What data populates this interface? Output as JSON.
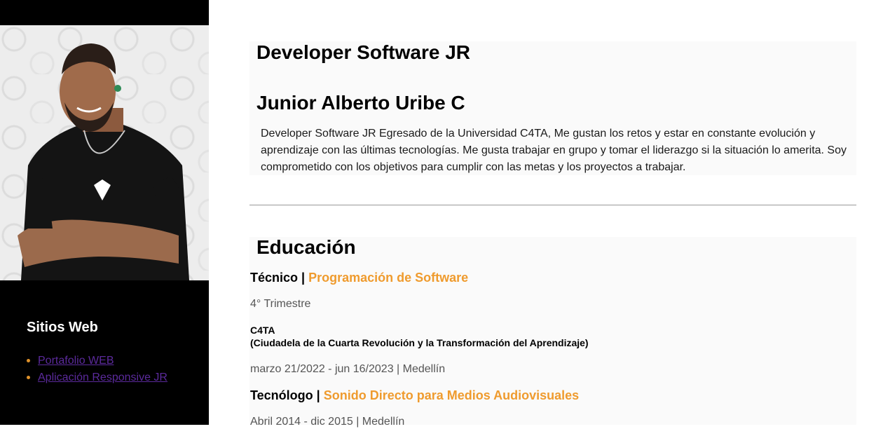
{
  "sidebar": {
    "photo_alt": "Foto de perfil",
    "sites_title": "Sitios Web",
    "links": [
      {
        "label": "Portafolio WEB"
      },
      {
        "label": "Aplicación Responsive JR"
      }
    ]
  },
  "intro": {
    "role": "Developer Software JR",
    "name": "Junior Alberto Uribe C",
    "bio": "Developer Software JR Egresado de la Universidad C4TA, Me gustan los retos y estar en constante evolución y aprendizaje con las últimas tecnologías. Me gusta trabajar en grupo y tomar el liderazgo si la situación lo amerita. Soy comprometido con los objetivos para cumplir con las metas y los proyectos a trabajar."
  },
  "education": {
    "title": "Educación",
    "entries": [
      {
        "degree": "Técnico",
        "separator": " | ",
        "field": "Programación de Software",
        "term": "4° Trimestre",
        "institution_short": "C4TA",
        "institution_long": "(Ciudadela de la Cuarta Revolución y la Transformación del Aprendizaje)",
        "dates": "marzo 21/2022 - jun 16/2023 | Medellín"
      },
      {
        "degree": "Tecnólogo",
        "separator": " | ",
        "field": "Sonido Directo para Medios Audiovisuales",
        "dates": "Abril 2014 - dic 2015 | Medellín"
      }
    ]
  },
  "colors": {
    "accent": "#ef9b2e",
    "sidebar_bg": "#000000",
    "link": "#5b2a9c"
  }
}
